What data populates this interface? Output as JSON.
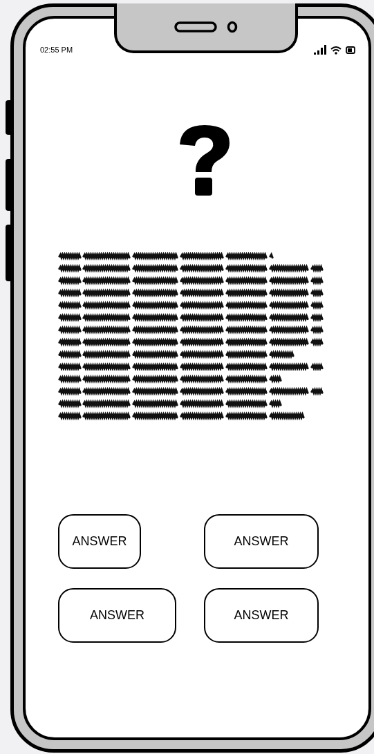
{
  "status_bar": {
    "time": "02:55 PM"
  },
  "answers": [
    {
      "label": "ANSWER"
    },
    {
      "label": "ANSWER"
    },
    {
      "label": "ANSWER"
    },
    {
      "label": "ANSWER"
    }
  ]
}
